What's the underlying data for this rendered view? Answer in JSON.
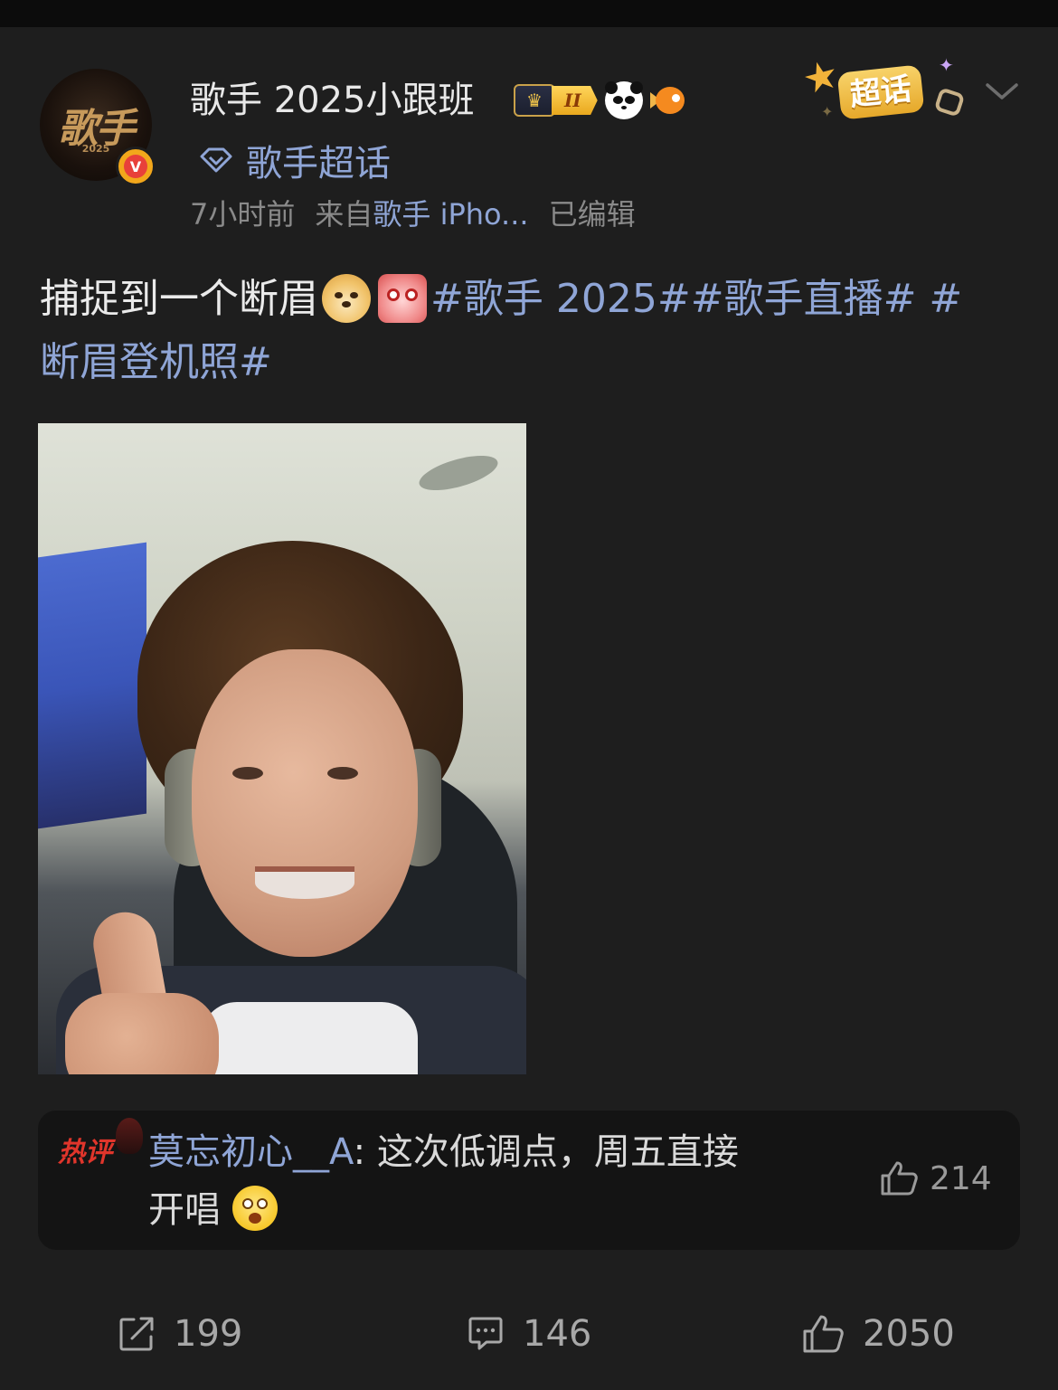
{
  "post": {
    "author": {
      "name": "歌手 2025小跟班",
      "avatar_text": "歌手",
      "avatar_year": "2025",
      "verified_mark": "V",
      "level_badge": "II"
    },
    "topic_link": "歌手超话",
    "meta": {
      "time": "7小时前",
      "source_prefix": "来自",
      "source": "歌手 iPho...",
      "edited": "已编辑"
    },
    "supertopic_label": "超话",
    "content": {
      "text": "捕捉到一个断眉",
      "tags_line1": "#歌手 2025##歌手直播# #",
      "tags_line2": "断眉登机照#"
    },
    "hot_comment": {
      "label": "热评",
      "author": "莫忘初心__A",
      "text_line1": ": 这次低调点，周五直接",
      "text_line2": "开唱",
      "likes": "214"
    },
    "actions": {
      "reposts": "199",
      "comments": "146",
      "likes": "2050"
    }
  },
  "icons": [
    "crown-icon",
    "panda-icon",
    "fish-icon",
    "diamond-icon",
    "star-icon",
    "chevron-down-icon",
    "thumbs-up-icon",
    "share-icon",
    "comment-icon"
  ]
}
